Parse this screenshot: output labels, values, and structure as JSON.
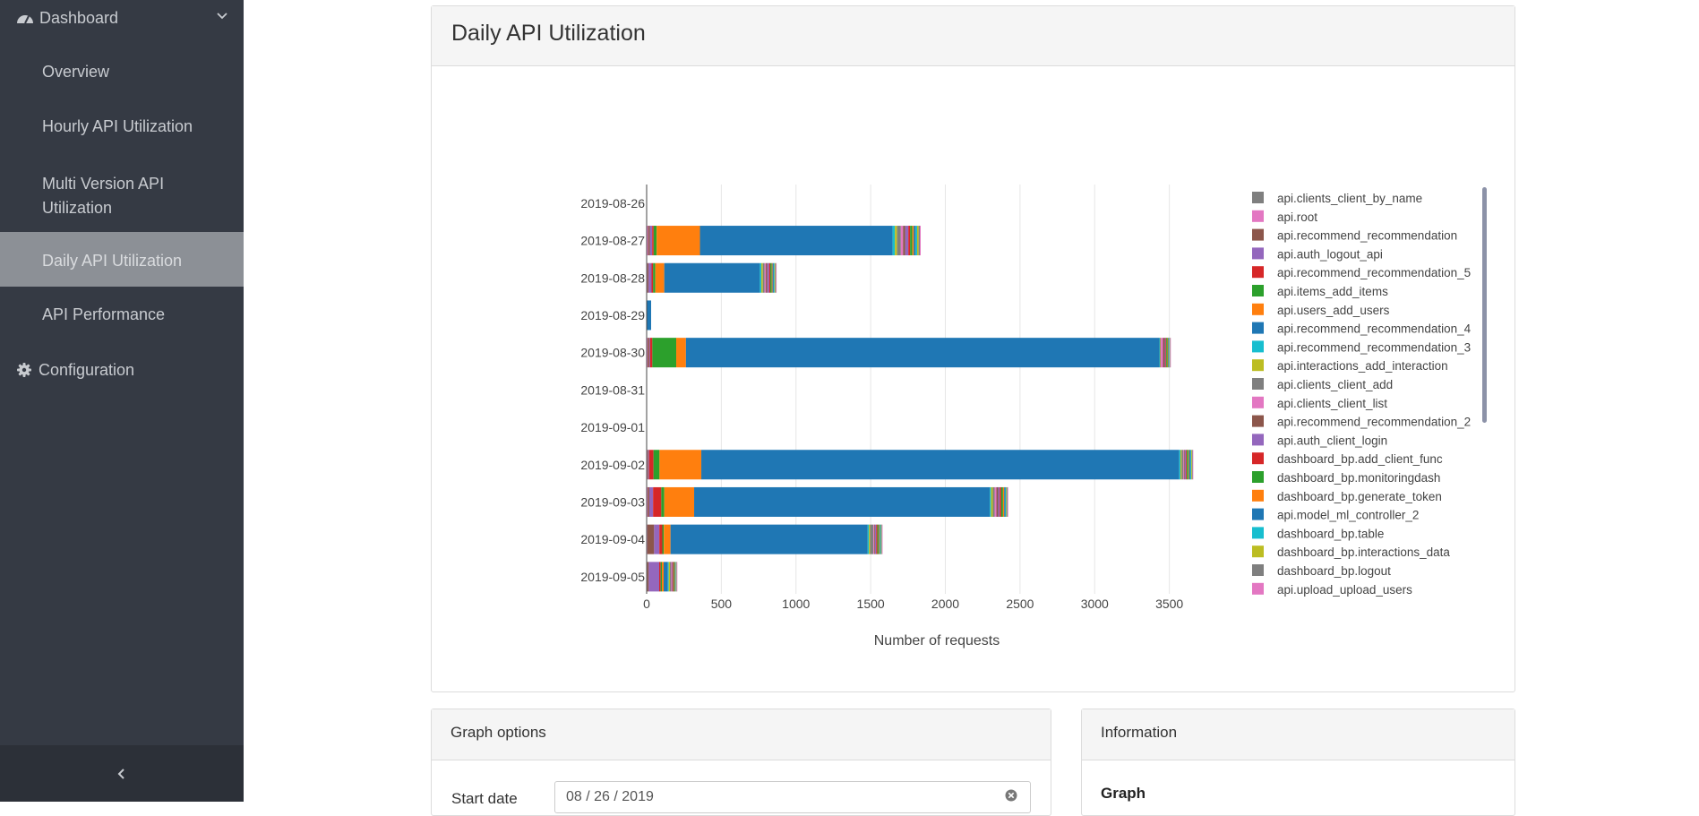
{
  "sidebar": {
    "dashboard_label": "Dashboard",
    "items": [
      {
        "label": "Overview"
      },
      {
        "label": "Hourly API Utilization"
      },
      {
        "label": "Multi Version API",
        "label2": "Utilization"
      },
      {
        "label": "Daily API Utilization",
        "active": true
      },
      {
        "label": "API Performance"
      }
    ],
    "configuration_label": "Configuration"
  },
  "main": {
    "title": "Daily API Utilization"
  },
  "graph_options": {
    "title": "Graph options",
    "start_date_label": "Start date",
    "start_date_value": "08 / 26 / 2019"
  },
  "information": {
    "title": "Information",
    "graph_heading": "Graph"
  },
  "chart_data": {
    "type": "bar",
    "orientation": "horizontal",
    "stacked": true,
    "categories": [
      "2019-08-26",
      "2019-08-27",
      "2019-08-28",
      "2019-08-29",
      "2019-08-30",
      "2019-08-31",
      "2019-09-01",
      "2019-09-02",
      "2019-09-03",
      "2019-09-04",
      "2019-09-05"
    ],
    "xlabel": "Number of requests",
    "ylabel": "",
    "xlim": [
      0,
      3700
    ],
    "xticks": [
      0,
      500,
      1000,
      1500,
      2000,
      2500,
      3000,
      3500
    ],
    "grid": true,
    "legend_position": "right",
    "series": [
      {
        "name": "api.clients_client_by_name",
        "color": "#7f7f7f",
        "values": [
          0,
          0,
          0,
          0,
          0,
          0,
          0,
          0,
          0,
          0,
          0
        ]
      },
      {
        "name": "api.root",
        "color": "#e377c2",
        "values": [
          0,
          10,
          5,
          0,
          8,
          0,
          0,
          5,
          8,
          5,
          4
        ]
      },
      {
        "name": "api.recommend_recommendation",
        "color": "#8c564b",
        "values": [
          0,
          12,
          8,
          0,
          10,
          0,
          0,
          6,
          10,
          45,
          10
        ]
      },
      {
        "name": "api.auth_logout_api",
        "color": "#9467bd",
        "values": [
          0,
          15,
          20,
          0,
          5,
          0,
          0,
          5,
          25,
          35,
          70
        ]
      },
      {
        "name": "api.recommend_recommendation_5",
        "color": "#d62728",
        "values": [
          0,
          10,
          10,
          0,
          15,
          0,
          0,
          30,
          55,
          20,
          10
        ]
      },
      {
        "name": "api.items_add_items",
        "color": "#2ca02c",
        "values": [
          0,
          20,
          15,
          0,
          160,
          0,
          0,
          40,
          20,
          10,
          8
        ]
      },
      {
        "name": "api.users_add_users",
        "color": "#ff7f0e",
        "values": [
          0,
          290,
          60,
          0,
          65,
          0,
          0,
          280,
          200,
          45,
          12
        ]
      },
      {
        "name": "api.recommend_recommendation_4",
        "color": "#1f77b4",
        "values": [
          0,
          1290,
          640,
          30,
          3170,
          0,
          0,
          3200,
          1980,
          1320,
          28
        ]
      },
      {
        "name": "api.recommend_recommendation_3",
        "color": "#17becf",
        "values": [
          0,
          15,
          10,
          0,
          3,
          0,
          0,
          8,
          8,
          8,
          6
        ]
      },
      {
        "name": "api.interactions_add_interaction",
        "color": "#bcbd22",
        "values": [
          0,
          15,
          10,
          0,
          3,
          0,
          0,
          8,
          12,
          8,
          8
        ]
      },
      {
        "name": "api.clients_client_add",
        "color": "#7f7f7f",
        "values": [
          0,
          25,
          12,
          0,
          3,
          0,
          0,
          10,
          12,
          22,
          6
        ]
      },
      {
        "name": "api.clients_client_list",
        "color": "#e377c2",
        "values": [
          0,
          15,
          8,
          0,
          15,
          0,
          0,
          5,
          12,
          6,
          4
        ]
      },
      {
        "name": "api.recommend_recommendation_2",
        "color": "#8c564b",
        "values": [
          0,
          15,
          10,
          0,
          12,
          0,
          0,
          6,
          12,
          5,
          4
        ]
      },
      {
        "name": "api.auth_client_login",
        "color": "#9467bd",
        "values": [
          0,
          20,
          12,
          0,
          5,
          0,
          0,
          8,
          10,
          8,
          5
        ]
      },
      {
        "name": "dashboard_bp.add_client_func",
        "color": "#d62728",
        "values": [
          0,
          12,
          8,
          0,
          5,
          0,
          0,
          6,
          10,
          8,
          5
        ]
      },
      {
        "name": "dashboard_bp.monitoringdash",
        "color": "#2ca02c",
        "values": [
          0,
          15,
          10,
          0,
          8,
          0,
          0,
          10,
          12,
          8,
          5
        ]
      },
      {
        "name": "dashboard_bp.generate_token",
        "color": "#ff7f0e",
        "values": [
          0,
          10,
          5,
          0,
          5,
          0,
          0,
          5,
          8,
          5,
          4
        ]
      },
      {
        "name": "api.model_ml_controller_2",
        "color": "#1f77b4",
        "values": [
          0,
          12,
          8,
          0,
          5,
          0,
          0,
          10,
          8,
          6,
          4
        ]
      },
      {
        "name": "dashboard_bp.table",
        "color": "#17becf",
        "values": [
          0,
          10,
          5,
          0,
          3,
          0,
          0,
          5,
          5,
          4,
          3
        ]
      },
      {
        "name": "dashboard_bp.interactions_data",
        "color": "#bcbd22",
        "values": [
          0,
          10,
          5,
          0,
          3,
          0,
          0,
          5,
          5,
          4,
          3
        ]
      },
      {
        "name": "dashboard_bp.logout",
        "color": "#7f7f7f",
        "values": [
          0,
          8,
          5,
          0,
          3,
          0,
          0,
          4,
          5,
          4,
          3
        ]
      },
      {
        "name": "api.upload_upload_users",
        "color": "#e377c2",
        "values": [
          0,
          6,
          4,
          0,
          2,
          0,
          0,
          4,
          4,
          3,
          2
        ]
      }
    ]
  }
}
